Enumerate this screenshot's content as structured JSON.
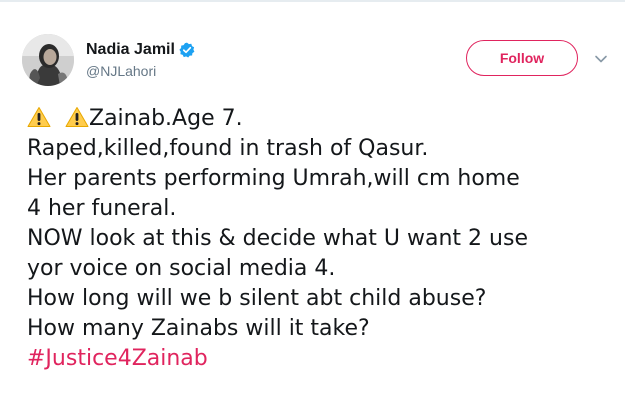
{
  "author": {
    "display_name": "Nadia Jamil",
    "handle": "@NJLahori",
    "verified": true
  },
  "actions": {
    "follow_label": "Follow",
    "accent_color": "#e0245e"
  },
  "icons": {
    "avatar": "profile-photo",
    "verified": "verified-badge-icon",
    "menu": "chevron-down-icon",
    "warning": "warning-icon"
  },
  "tweet": {
    "line1_text": "Zainab.Age 7.",
    "lines": [
      "Raped,killed,found in trash of Qasur.",
      "Her parents performing Umrah,will cm home",
      "4 her funeral.",
      "NOW look at this & decide what U want 2 use",
      "yor voice on social media 4.",
      "How long will we b silent abt child abuse?",
      "How many Zainabs will it take?"
    ],
    "hashtag": "#Justice4Zainab"
  }
}
